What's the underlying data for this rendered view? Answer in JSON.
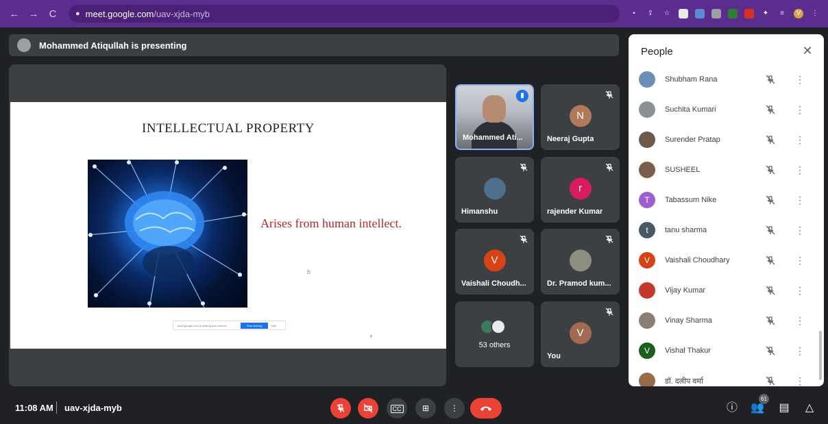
{
  "browser": {
    "url_host": "meet.google.com",
    "url_path": "/uav-xjda-myb",
    "profile_initial": "V"
  },
  "presenting_banner": {
    "text": "Mohammed Atiqullah is presenting"
  },
  "slide": {
    "title": "INTELLECTUAL PROPERTY",
    "body": "Arises from human intellect.",
    "share_bar_text": "meet.google.com is sharing your screen.",
    "share_bar_button": "Stop sharing",
    "share_bar_hide": "Hide",
    "cursor_glyph": "b"
  },
  "tiles": [
    {
      "name": "Mohammed Ati...",
      "type": "video",
      "speaking": true
    },
    {
      "name": "Neeraj Gupta",
      "initial": "N",
      "color": "#b07a5b",
      "muted": true
    },
    {
      "name": "Himanshu",
      "initial": "",
      "color": "#4f6f8f",
      "muted": true,
      "photo": true
    },
    {
      "name": "rajender Kumar",
      "initial": "r",
      "color": "#d81b60",
      "muted": true
    },
    {
      "name": "Vaishali Choudh...",
      "initial": "V",
      "color": "#d84315",
      "muted": true
    },
    {
      "name": "Dr. Pramod kum...",
      "initial": "",
      "color": "#8d8d80",
      "muted": true,
      "photo": true
    },
    {
      "name": "53 others",
      "type": "others"
    },
    {
      "name": "You",
      "initial": "V",
      "color": "#a26a52",
      "muted": true
    }
  ],
  "people_panel": {
    "title": "People",
    "close_glyph": "✕",
    "people": [
      {
        "name": "Shubham Rana",
        "initial": "",
        "color": "#6b8fb3"
      },
      {
        "name": "Suchita Kumari",
        "initial": "",
        "color": "#8a8f95"
      },
      {
        "name": "Surender Pratap",
        "initial": "",
        "color": "#6d5a4a"
      },
      {
        "name": "SUSHEEL",
        "initial": "",
        "color": "#7a5d4b"
      },
      {
        "name": "Tabassum Nike",
        "initial": "T",
        "color": "#9c5fd0"
      },
      {
        "name": "tanu sharma",
        "initial": "t",
        "color": "#455a64"
      },
      {
        "name": "Vaishali Choudhary",
        "initial": "V",
        "color": "#d84315"
      },
      {
        "name": "Vijay Kumar",
        "initial": "",
        "color": "#c0392b"
      },
      {
        "name": "Vinay Sharma",
        "initial": "",
        "color": "#8a7f74"
      },
      {
        "name": "Vishal Thakur",
        "initial": "V",
        "color": "#1b5e20"
      },
      {
        "name": "डॉ. दलीप वर्मा",
        "initial": "",
        "color": "#9a6b4a"
      }
    ]
  },
  "bottom_bar": {
    "time": "11:08 AM",
    "meeting_code": "uav-xjda-myb",
    "participants_count": "61"
  }
}
